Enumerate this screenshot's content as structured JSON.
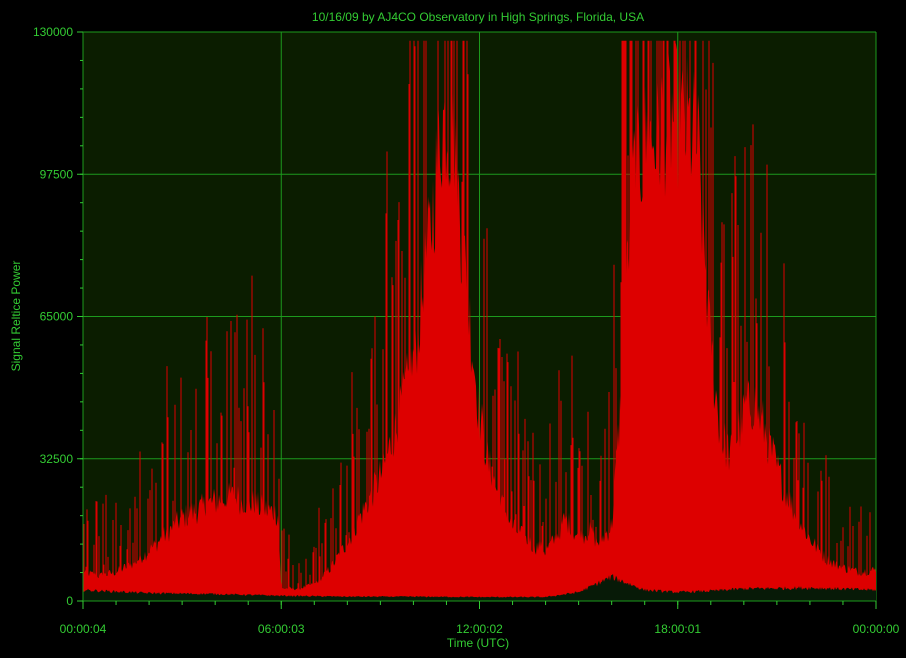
{
  "chart_data": {
    "type": "area",
    "title": "10/16/09  by  AJ4CO Observatory  in  High Springs, Florida, USA",
    "xlabel": "Time (UTC)",
    "ylabel": "Signal Reltice Power",
    "x_tick_labels": [
      "00:00:04",
      "06:00:03",
      "12:00:02",
      "18:00:01",
      "00:00:00"
    ],
    "x_range_hours": [
      0,
      24
    ],
    "ylim": [
      0,
      130000
    ],
    "y_ticks": [
      0,
      32500,
      65000,
      97500,
      130000
    ],
    "y_tick_labels": [
      "0",
      "32500",
      "65000",
      "97500",
      "130000"
    ],
    "grid": true,
    "colors": {
      "background": "#000000",
      "plot_background": "#0b1d00",
      "grid": "#1d9a1d",
      "text": "#33cc33",
      "series_main": "#dd0000",
      "series_secondary": "#071a07"
    },
    "series": [
      {
        "role": "main",
        "x_hours": [
          0,
          0.5,
          1,
          1.5,
          2,
          2.5,
          3,
          3.5,
          4,
          4.5,
          5,
          5.5,
          5.9,
          6.0,
          6.5,
          7,
          7.5,
          8,
          8.5,
          9,
          9.5,
          10,
          10.3,
          10.6,
          10.8,
          11,
          11.2,
          11.5,
          11.8,
          12,
          12.3,
          12.6,
          13,
          13.5,
          14,
          14.3,
          14.6,
          15,
          15.3,
          15.6,
          16,
          16.3,
          16.6,
          17,
          17.3,
          17.6,
          18,
          18.3,
          18.6,
          19,
          19.3,
          19.6,
          20,
          20.3,
          20.6,
          21,
          21.5,
          22,
          22.5,
          23,
          23.5,
          24
        ],
        "upper": [
          7000,
          6000,
          7000,
          9000,
          12000,
          16000,
          20000,
          22000,
          24000,
          25000,
          24000,
          22000,
          21000,
          3000,
          3000,
          4000,
          8000,
          14000,
          22000,
          30000,
          42000,
          58000,
          75000,
          95000,
          113000,
          117000,
          110000,
          85000,
          60000,
          45000,
          32000,
          25000,
          18000,
          14000,
          12000,
          15000,
          20000,
          15000,
          17000,
          14000,
          18000,
          50000,
          100000,
          110000,
          112000,
          115000,
          117000,
          114000,
          110000,
          60000,
          40000,
          35000,
          45000,
          48000,
          42000,
          32000,
          22000,
          15000,
          10000,
          8000,
          7000,
          7500
        ],
        "spike_range": [
          0,
          128000
        ]
      },
      {
        "role": "secondary",
        "x_hours": [
          0,
          2,
          4,
          6,
          8,
          10,
          12,
          14,
          15,
          16,
          17,
          18,
          19,
          20,
          22,
          24
        ],
        "upper": [
          2500,
          1800,
          1600,
          1200,
          1000,
          1000,
          900,
          900,
          2000,
          5500,
          2500,
          2000,
          2300,
          2800,
          3000,
          2500
        ]
      }
    ]
  }
}
